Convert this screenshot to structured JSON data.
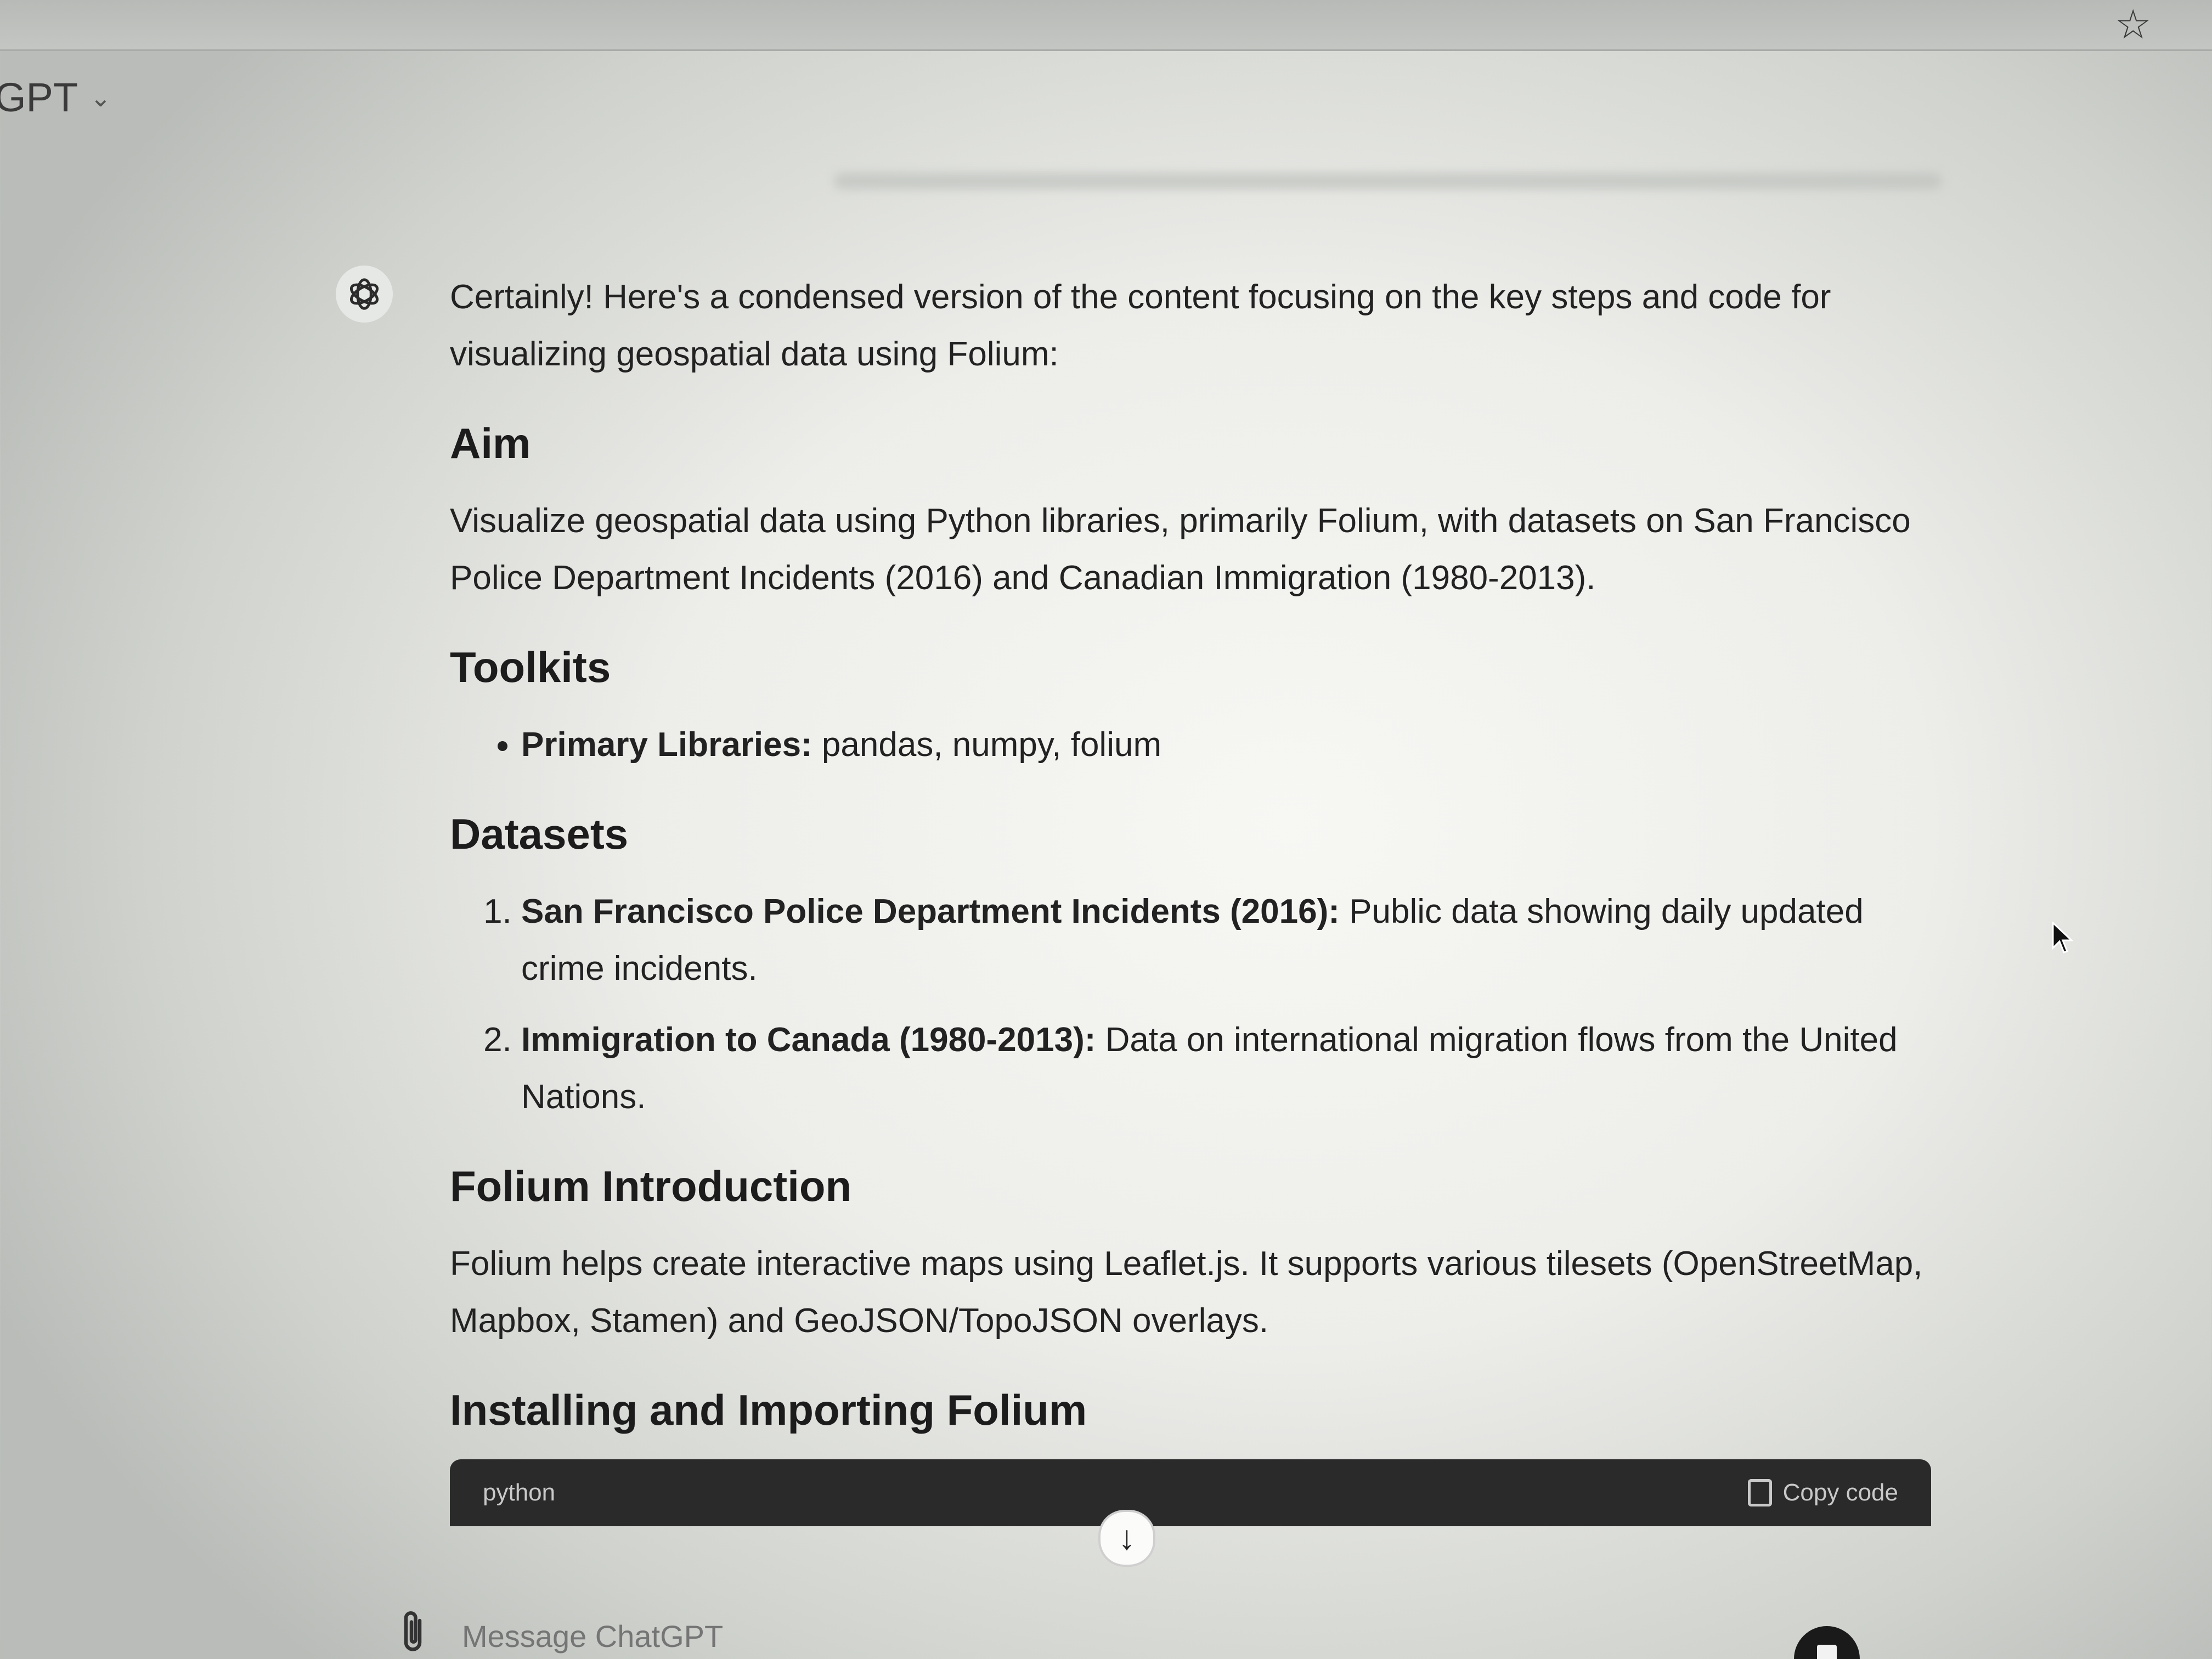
{
  "header": {
    "model_name": "GPT",
    "model_chevron": "⌄",
    "star_icon": "☆"
  },
  "message": {
    "intro": "Certainly! Here's a condensed version of the content focusing on the key steps and code for visualizing geospatial data using Folium:",
    "sections": {
      "aim": {
        "heading": "Aim",
        "text": "Visualize geospatial data using Python libraries, primarily Folium, with datasets on San Francisco Police Department Incidents (2016) and Canadian Immigration (1980-2013)."
      },
      "toolkits": {
        "heading": "Toolkits",
        "items": [
          {
            "label": "Primary Libraries:",
            "text": " pandas, numpy, folium"
          }
        ]
      },
      "datasets": {
        "heading": "Datasets",
        "items": [
          {
            "label": "San Francisco Police Department Incidents (2016):",
            "text": " Public data showing daily updated crime incidents."
          },
          {
            "label": "Immigration to Canada (1980-2013):",
            "text": " Data on international migration flows from the United Nations."
          }
        ]
      },
      "folium_intro": {
        "heading": "Folium Introduction",
        "text": "Folium helps create interactive maps using Leaflet.js. It supports various tilesets (OpenStreetMap, Mapbox, Stamen) and GeoJSON/TopoJSON overlays."
      },
      "installing": {
        "heading": "Installing and Importing Folium"
      }
    },
    "code_block": {
      "language": "python",
      "copy_label": "Copy code"
    }
  },
  "scroll_down_icon": "↓",
  "composer": {
    "placeholder": "Message ChatGPT"
  }
}
